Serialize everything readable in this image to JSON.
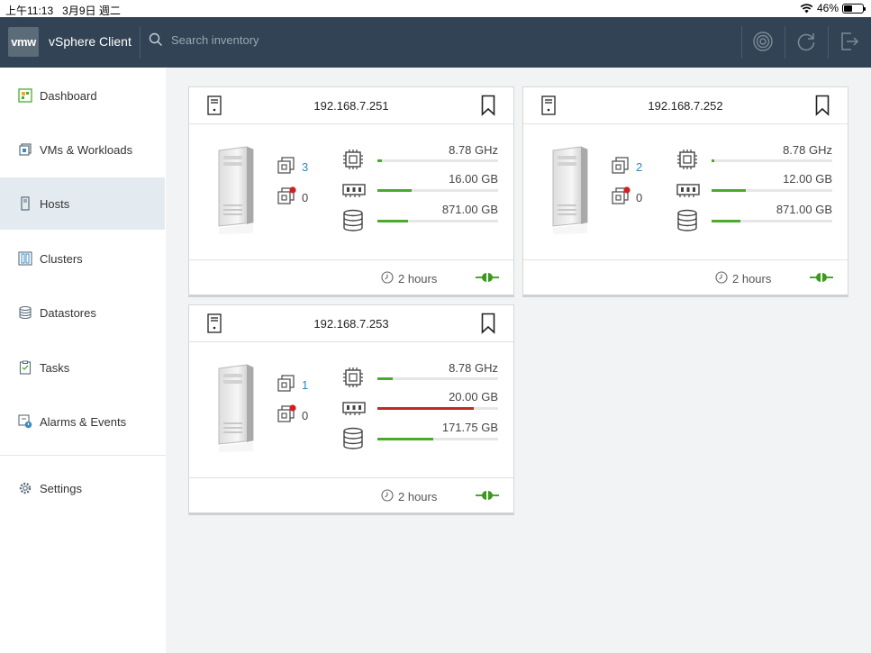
{
  "statusbar": {
    "time": "上午11:13",
    "date": "3月9日 週二",
    "battery": "46%"
  },
  "header": {
    "logo": "vmw",
    "title": "vSphere Client",
    "search_placeholder": "Search inventory"
  },
  "sidebar": {
    "items": [
      {
        "label": "Dashboard",
        "icon": "dashboard-icon"
      },
      {
        "label": "VMs & Workloads",
        "icon": "vm-icon"
      },
      {
        "label": "Hosts",
        "icon": "host-icon",
        "active": true
      },
      {
        "label": "Clusters",
        "icon": "cluster-icon"
      },
      {
        "label": "Datastores",
        "icon": "datastore-icon"
      },
      {
        "label": "Tasks",
        "icon": "tasks-icon"
      },
      {
        "label": "Alarms & Events",
        "icon": "alarm-icon"
      }
    ],
    "settings": {
      "label": "Settings",
      "icon": "gear-icon"
    }
  },
  "hosts": [
    {
      "ip": "192.168.7.251",
      "vms_on": "3",
      "vms_off": "0",
      "cpu": "8.78 GHz",
      "cpu_usage": 0.04,
      "memory": "16.00 GB",
      "memory_usage": 0.28,
      "storage": "871.00 GB",
      "storage_usage": 0.25,
      "uptime": "2 hours"
    },
    {
      "ip": "192.168.7.252",
      "vms_on": "2",
      "vms_off": "0",
      "cpu": "8.78 GHz",
      "cpu_usage": 0.02,
      "memory": "12.00 GB",
      "memory_usage": 0.28,
      "storage": "871.00 GB",
      "storage_usage": 0.24,
      "uptime": "2 hours"
    },
    {
      "ip": "192.168.7.253",
      "vms_on": "1",
      "vms_off": "0",
      "cpu": "8.78 GHz",
      "cpu_usage": 0.13,
      "memory": "20.00 GB",
      "memory_usage": 0.8,
      "storage": "171.75 GB",
      "storage_usage": 0.46,
      "uptime": "2 hours"
    }
  ],
  "colors": {
    "header_bg": "#314354",
    "accent_green": "#4aaa2b",
    "alert_red": "#c12b1d",
    "link_blue": "#2e86c1"
  }
}
